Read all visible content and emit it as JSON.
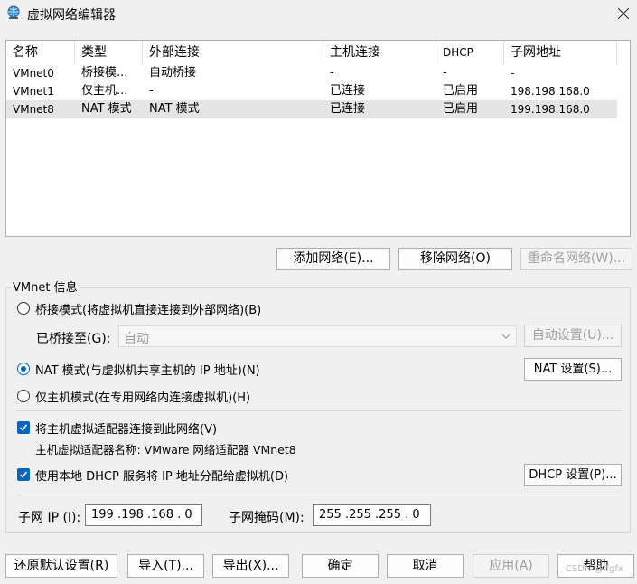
{
  "window": {
    "title": "虚拟网络编辑器",
    "app_icon": "globe-network-icon",
    "close_icon": "close-icon"
  },
  "table": {
    "headers": [
      "名称",
      "类型",
      "外部连接",
      "主机连接",
      "DHCP",
      "子网地址"
    ],
    "rows": [
      [
        "VMnet0",
        "桥接模...",
        "自动桥接",
        "-",
        "-",
        "-"
      ],
      [
        "VMnet1",
        "仅主机...",
        "-",
        "已连接",
        "已启用",
        "198.198.168.0"
      ],
      [
        "VMnet8",
        "NAT 模式",
        "NAT 模式",
        "已连接",
        "已启用",
        "199.198.168.0"
      ]
    ],
    "selected_row": 2
  },
  "list_buttons": {
    "add": "添加网络(E)...",
    "remove": "移除网络(O)",
    "rename": "重命名网络(W)..."
  },
  "vmnet_info": {
    "group_label": "VMnet 信息",
    "bridged_label": "桥接模式(将虚拟机直接连接到外部网络)(B)",
    "bridged_to_label": "已桥接至(G):",
    "bridged_to_value": "自动",
    "auto_settings": "自动设置(U)...",
    "nat_label": "NAT 模式(与虚拟机共享主机的 IP 地址)(N)",
    "nat_settings": "NAT 设置(S)...",
    "hostonly_label": "仅主机模式(在专用网络内连接虚拟机)(H)",
    "selected_mode": "nat",
    "connect_adapter_label": "将主机虚拟适配器连接到此网络(V)",
    "connect_adapter_checked": true,
    "adapter_name_label": "主机虚拟适配器名称: VMware 网络适配器 VMnet8",
    "dhcp_label": "使用本地 DHCP 服务将 IP 地址分配给虚拟机(D)",
    "dhcp_checked": true,
    "dhcp_settings": "DHCP 设置(P)...",
    "subnet_ip_label": "子网 IP (I):",
    "subnet_ip_value": "199 .198 .168 . 0",
    "subnet_mask_label": "子网掩码(M):",
    "subnet_mask_value": "255 .255 .255 . 0"
  },
  "footer_buttons": {
    "restore": "还原默认设置(R)",
    "import": "导入(T)...",
    "export": "导出(X)...",
    "ok": "确定",
    "cancel": "取消",
    "apply": "应用(A)",
    "help": "帮助"
  },
  "watermark": "CSDN @lfgfx",
  "colors": {
    "accent": "#0067c0",
    "selected_row": "#e5e5e5",
    "background": "#f0f0f0"
  }
}
